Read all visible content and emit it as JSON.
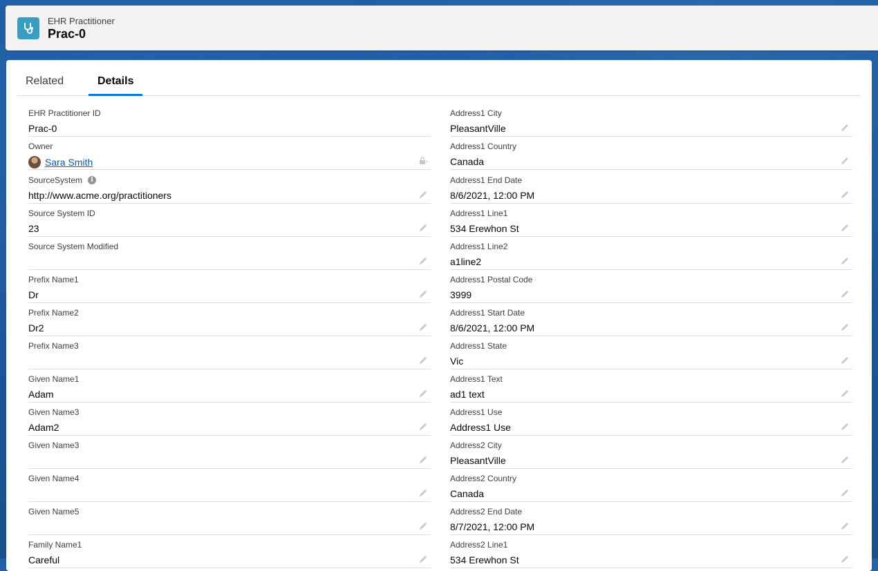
{
  "header": {
    "object_type": "EHR Practitioner",
    "record_name": "Prac-0"
  },
  "tabs": [
    {
      "label": "Related",
      "active": false
    },
    {
      "label": "Details",
      "active": true
    }
  ],
  "left_fields": [
    {
      "label": "EHR Practitioner ID",
      "value": "Prac-0"
    },
    {
      "label": "Owner",
      "value": "Sara Smith"
    },
    {
      "label": "SourceSystem",
      "value": "http://www.acme.org/practitioners"
    },
    {
      "label": "Source System ID",
      "value": "23"
    },
    {
      "label": "Source System Modified",
      "value": ""
    },
    {
      "label": "Prefix Name1",
      "value": "Dr"
    },
    {
      "label": "Prefix Name2",
      "value": "Dr2"
    },
    {
      "label": "Prefix Name3",
      "value": ""
    },
    {
      "label": "Given Name1",
      "value": "Adam"
    },
    {
      "label": "Given Name3",
      "value": "Adam2"
    },
    {
      "label": "Given Name3",
      "value": ""
    },
    {
      "label": "Given Name4",
      "value": ""
    },
    {
      "label": "Given Name5",
      "value": ""
    },
    {
      "label": "Family Name1",
      "value": "Careful"
    }
  ],
  "right_fields": [
    {
      "label": "Address1 City",
      "value": "PleasantVille"
    },
    {
      "label": "Address1 Country",
      "value": "Canada"
    },
    {
      "label": "Address1 End Date",
      "value": "8/6/2021, 12:00 PM"
    },
    {
      "label": "Address1 Line1",
      "value": "534 Erewhon St"
    },
    {
      "label": "Address1 Line2",
      "value": "a1line2"
    },
    {
      "label": "Address1 Postal Code",
      "value": "3999"
    },
    {
      "label": "Address1 Start Date",
      "value": "8/6/2021, 12:00 PM"
    },
    {
      "label": "Address1 State",
      "value": "Vic"
    },
    {
      "label": "Address1 Text",
      "value": "ad1 text"
    },
    {
      "label": "Address1 Use",
      "value": "Address1 Use"
    },
    {
      "label": "Address2 City",
      "value": "PleasantVille"
    },
    {
      "label": "Address2 Country",
      "value": "Canada"
    },
    {
      "label": "Address2 End Date",
      "value": "8/7/2021, 12:00 PM"
    },
    {
      "label": "Address2 Line1",
      "value": "534 Erewhon St"
    }
  ],
  "colors": {
    "brand_blue": "#0176d3",
    "link": "#0b5cab",
    "icon_bg": "#3a9cc0"
  }
}
